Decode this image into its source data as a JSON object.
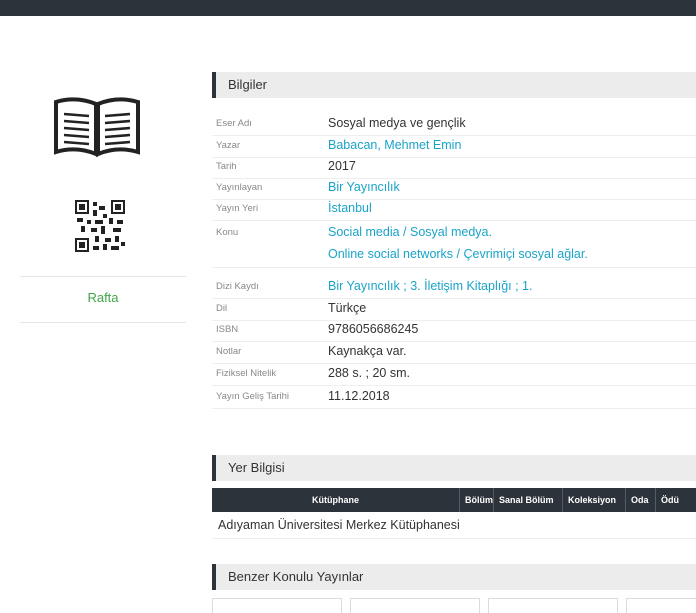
{
  "left": {
    "book_icon": "open-book-icon",
    "qr_icon": "qr-code-icon",
    "status": "Rafta"
  },
  "info": {
    "title": "Bilgiler",
    "rows": [
      {
        "label": "Eser Adı",
        "value": "Sosyal medya ve gençlik",
        "link": false
      },
      {
        "label": "Yazar",
        "value": "Babacan, Mehmet Emin",
        "link": true
      },
      {
        "label": "Tarih",
        "value": "2017",
        "link": false
      },
      {
        "label": "Yayınlayan",
        "value": "Bir Yayıncılık",
        "link": true
      },
      {
        "label": "Yayın Yeri",
        "value": "İstanbul",
        "link": true
      },
      {
        "label": "Konu",
        "value": "Social media / Sosyal medya.",
        "value2": "Online social networks / Çevrimiçi sosyal ağlar.",
        "link": true
      },
      {
        "label": "Dizi Kaydı",
        "value": "Bir Yayıncılık ; 3. İletişim Kitaplığı ; 1.",
        "link": true
      },
      {
        "label": "Dil",
        "value": "Türkçe",
        "link": false
      },
      {
        "label": "ISBN",
        "value": "9786056686245",
        "link": false
      },
      {
        "label": "Notlar",
        "value": "Kaynakça var.",
        "link": false
      },
      {
        "label": "Fiziksel Nitelik",
        "value": "288 s. ; 20 sm.",
        "link": false
      },
      {
        "label": "Yayın Geliş Tarihi",
        "value": "11.12.2018",
        "link": false
      }
    ]
  },
  "location": {
    "title": "Yer Bilgisi",
    "headers": [
      "Kütüphane",
      "Bölüm",
      "Sanal Bölüm",
      "Koleksiyon",
      "Oda",
      "Ödü"
    ],
    "rows": [
      [
        "Adıyaman Üniversitesi Merkez Kütüphanesi"
      ]
    ]
  },
  "similar": {
    "title": "Benzer Konulu Yayınlar"
  }
}
